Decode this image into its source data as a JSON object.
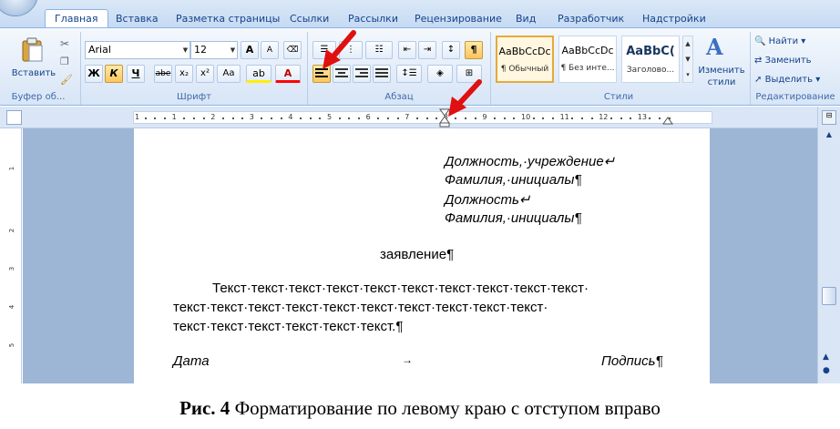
{
  "tabs": [
    "Главная",
    "Вставка",
    "Разметка страницы",
    "Ссылки",
    "Рассылки",
    "Рецензирование",
    "Вид",
    "Разработчик",
    "Надстройки"
  ],
  "clipboard": {
    "paste_label": "Вставить",
    "group": "Буфер об...",
    "icons": [
      "cut-icon",
      "copy-icon",
      "format-painter-icon"
    ]
  },
  "font": {
    "name": "Arial",
    "size": "12",
    "group": "Шрифт",
    "bold": "Ж",
    "italic": "К",
    "underline": "Ч",
    "strike": "abe",
    "sub": "x₂",
    "sup": "x²",
    "case": "Aa",
    "grow": "A",
    "shrink": "A",
    "color_a": "A"
  },
  "paragraph": {
    "group": "Абзац"
  },
  "styles": {
    "group": "Стили",
    "items": [
      {
        "preview": "AaBbCcDc",
        "name": "¶ Обычный"
      },
      {
        "preview": "AaBbCcDc",
        "name": "¶ Без инте..."
      },
      {
        "preview": "AaBbC(",
        "name": "Заголово..."
      }
    ],
    "change_label": "Изменить стили"
  },
  "editing": {
    "group": "Редактирование",
    "find": "Найти",
    "replace": "Заменить",
    "select": "Выделить"
  },
  "ruler": {
    "numbers": [
      "1",
      "1",
      "2",
      "3",
      "4",
      "5",
      "6",
      "7",
      "8",
      "9",
      "10",
      "11",
      "12",
      "13"
    ]
  },
  "document": {
    "lines_right": [
      "Должность,·учреждение↵",
      "Фамилия,·инициалы¶",
      "Должность↵",
      "Фамилия,·инициалы¶"
    ],
    "title": "заявление¶",
    "body": [
      "Текст·текст·текст·текст·текст·текст·текст·текст·текст·текст·",
      "текст·текст·текст·текст·текст·текст·текст·текст·текст·текст·",
      "текст·текст·текст·текст·текст·текст.¶"
    ],
    "date": "Дата",
    "tab_arrow": "→",
    "signature": "Подпись¶"
  },
  "caption": {
    "bold": "Рис. 4",
    "text": " Форматирование по левому краю с отступом вправо"
  }
}
